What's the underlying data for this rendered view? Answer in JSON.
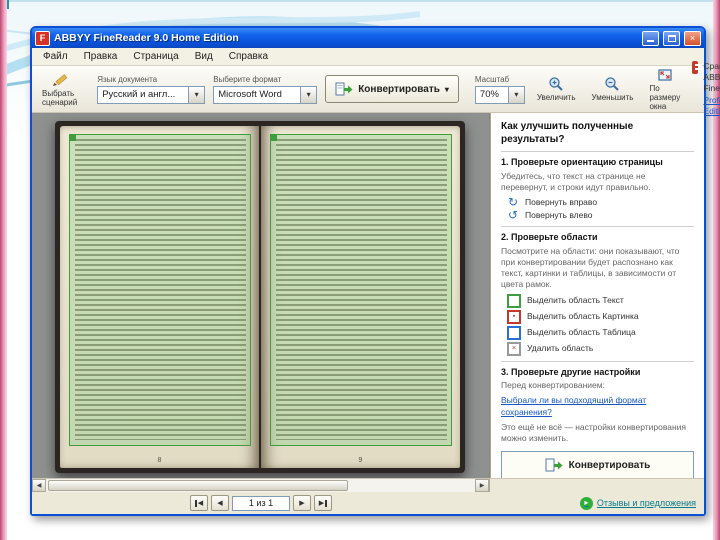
{
  "window": {
    "title": "ABBYY FineReader 9.0 Home Edition",
    "close_glyph": "×"
  },
  "menu": {
    "items": [
      "Файл",
      "Правка",
      "Страница",
      "Вид",
      "Справка"
    ]
  },
  "toolbar": {
    "scenario": "Выбрать сценарий",
    "lang_label": "Язык документа",
    "lang_value": "Русский и англ...",
    "format_label": "Выберите формат",
    "format_value": "Microsoft Word",
    "convert": "Конвертировать",
    "zoom_label": "Масштаб",
    "zoom_value": "70%",
    "zoom_in": "Увеличить",
    "zoom_out": "Уменьшить",
    "fit": "По размеру окна",
    "upsell_line1": "Сравни с ABBYY FineReader",
    "upsell_line2": "Professional Edition"
  },
  "document": {
    "left_page_number": "8",
    "right_page_number": "9"
  },
  "panel": {
    "title": "Как улучшить полученные результаты?",
    "step1_heading": "1. Проверьте ориентацию страницы",
    "step1_text": "Убедитесь, что текст на странице не перевернут, и строки идут правильно.",
    "rotate_right": "Повернуть вправо",
    "rotate_left": "Повернуть влево",
    "step2_heading": "2. Проверьте области",
    "step2_text": "Посмотрите на области: они показывают, что при конвертировании будет распознано как текст, картинки и таблицы, в зависимости от цвета рамок.",
    "area_text": "Выделить область Текст",
    "area_picture": "Выделить область Картинка",
    "area_table": "Выделить область Таблица",
    "area_delete": "Удалить область",
    "step3_heading": "3. Проверьте другие настройки",
    "step3_text1": "Перед конвертированием:",
    "step3_link": "Выбрали ли вы подходящий формат сохранения?",
    "step3_text2": "Это ещё не всё — настройки конвертирования можно изменить.",
    "convert": "Конвертировать"
  },
  "pager": {
    "first": "◀",
    "prev": "◀",
    "value": "1 из 1",
    "next": "▶",
    "last": "▶"
  },
  "footer": {
    "link": "Отзывы и предложения"
  },
  "icons": {
    "dropdown_arrow": "▾",
    "caret": "▾",
    "rotate_right": "↻",
    "rotate_left": "↺",
    "delete_cross": "×",
    "picture_dot": "▪",
    "scroll_left": "◀",
    "scroll_right": "▶",
    "play": "▸",
    "app_letter": "F"
  }
}
